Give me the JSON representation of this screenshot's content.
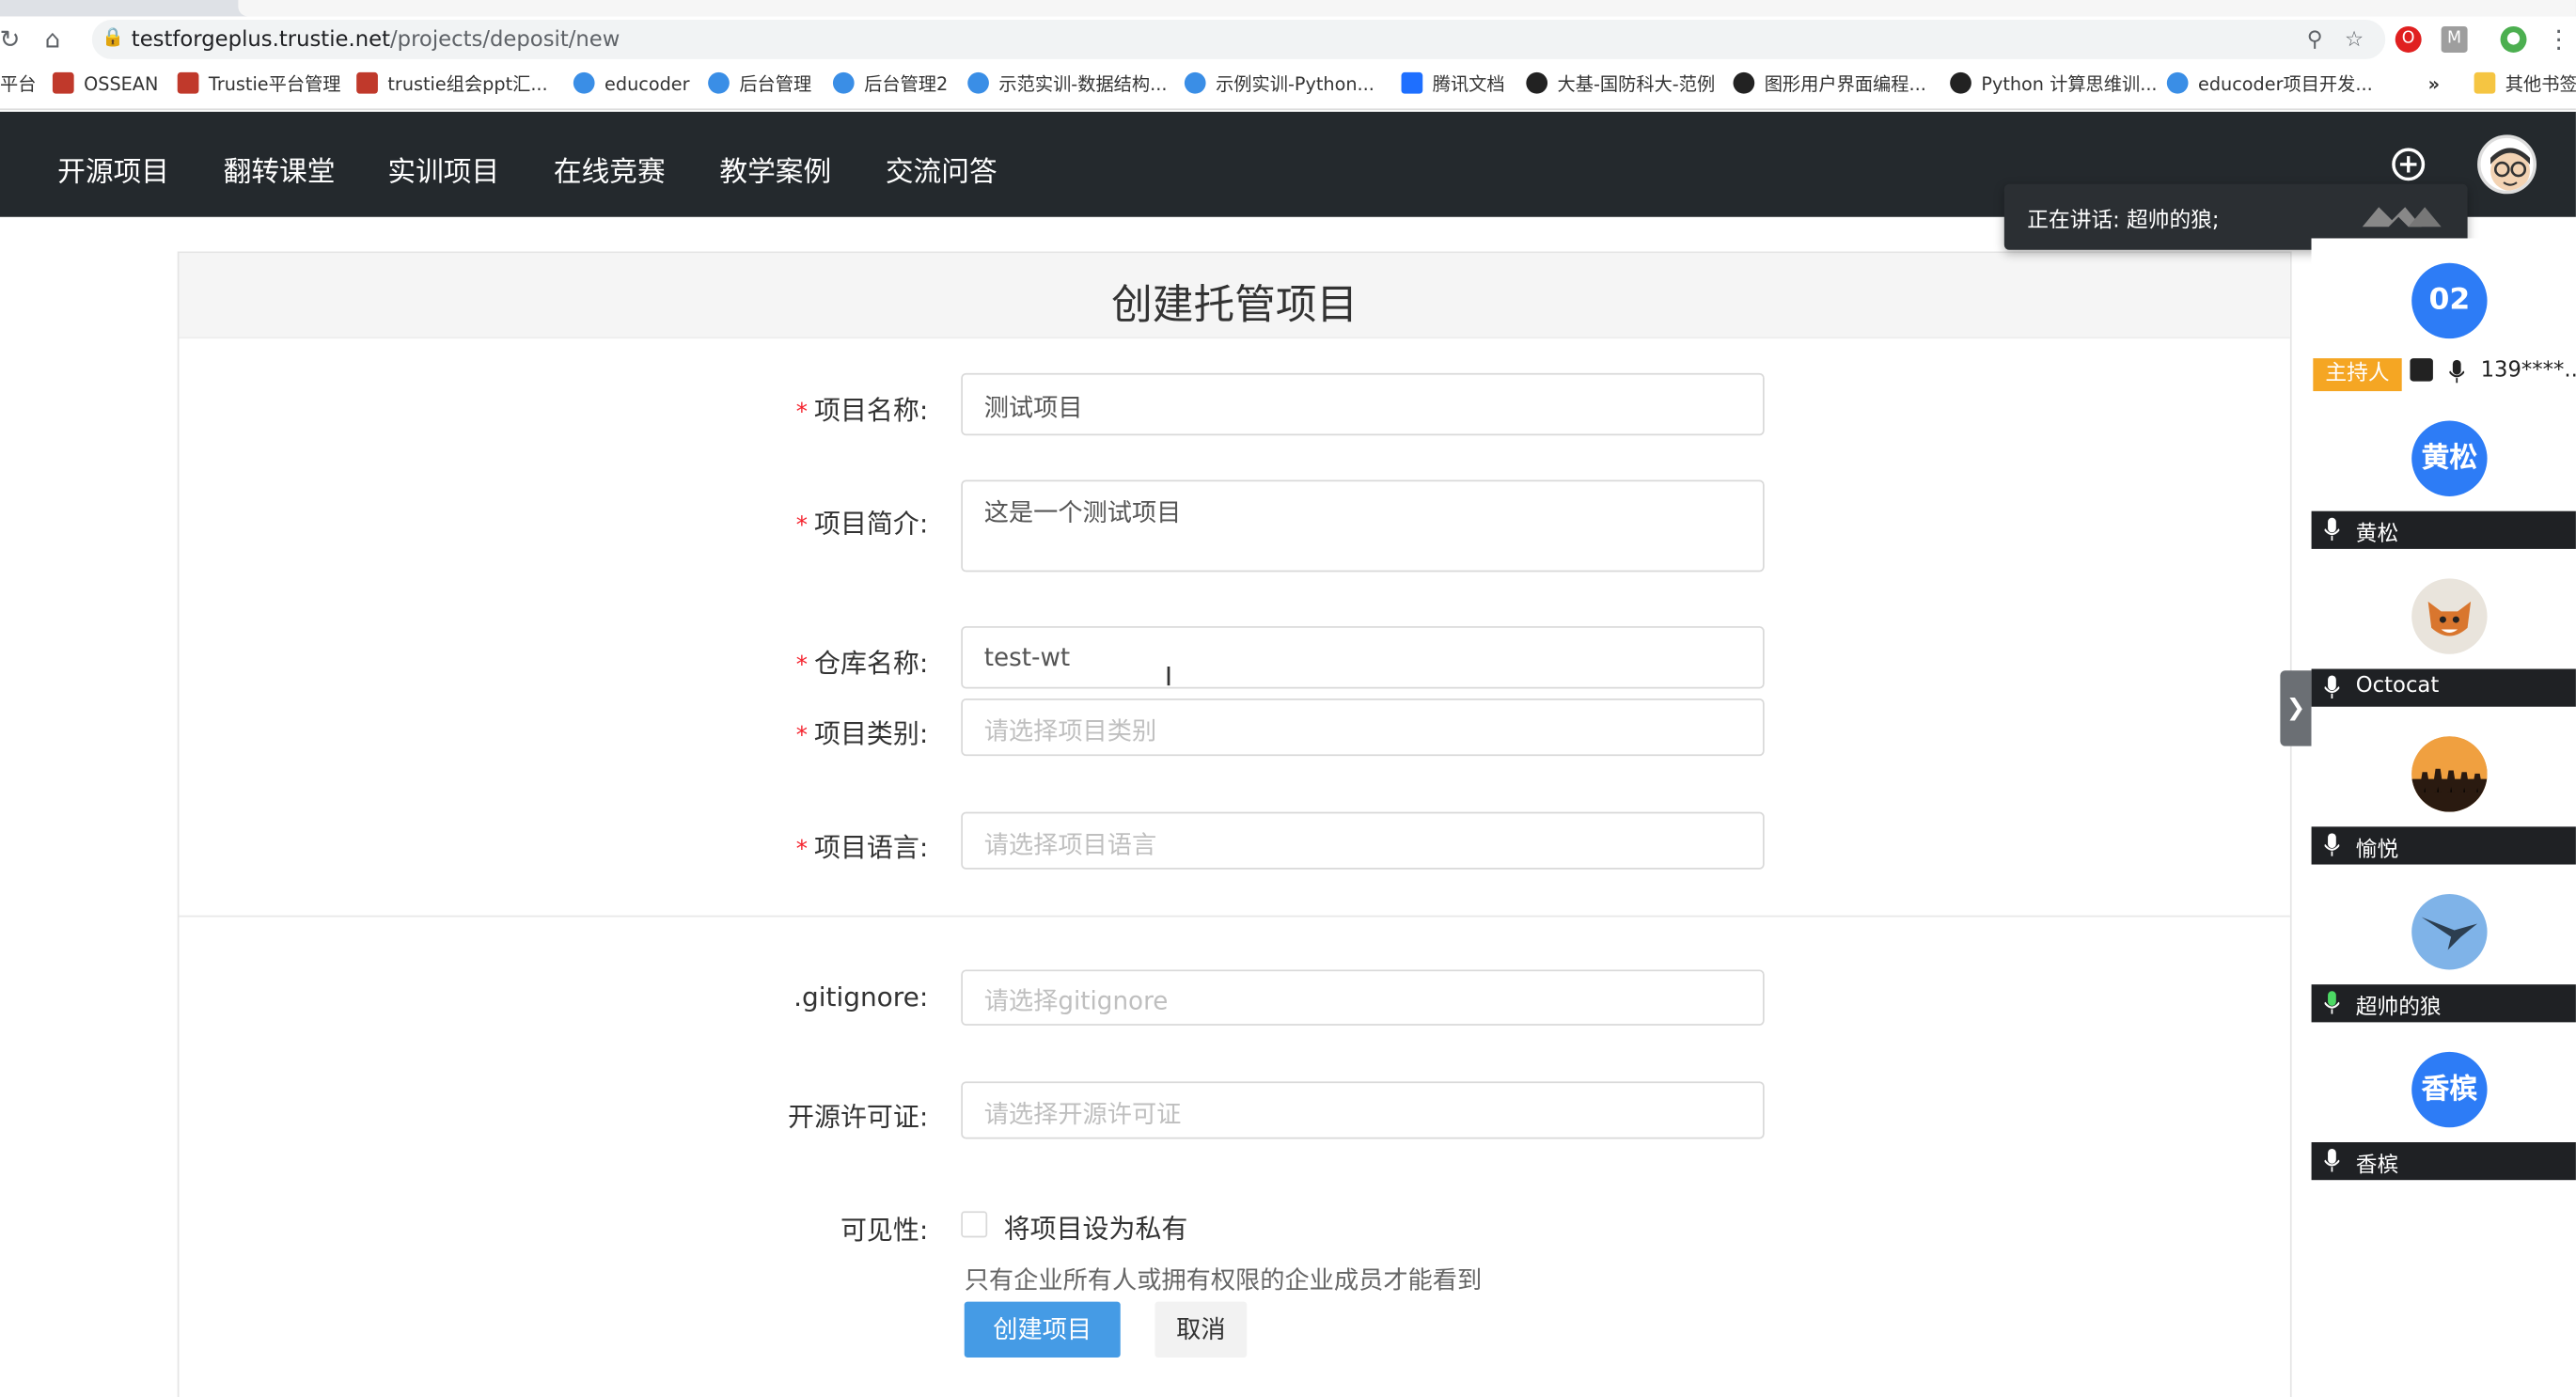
{
  "browser": {
    "url_host": "testforgeplus.trustie.net",
    "url_path": "/projects/deposit/new"
  },
  "bookmarks": [
    {
      "label": "平台",
      "icon": "bookmark-cut-icon"
    },
    {
      "label": "OSSEAN",
      "icon": "red-building-icon"
    },
    {
      "label": "Trustie平台管理",
      "icon": "red-building-icon"
    },
    {
      "label": "trustie组会ppt汇...",
      "icon": "red-building-icon"
    },
    {
      "label": "educoder",
      "icon": "blue-circle-icon"
    },
    {
      "label": "后台管理",
      "icon": "blue-circle-icon"
    },
    {
      "label": "后台管理2",
      "icon": "blue-circle-icon"
    },
    {
      "label": "示范实训-数据结构...",
      "icon": "blue-circle-icon"
    },
    {
      "label": "示例实训-Python...",
      "icon": "blue-circle-icon"
    },
    {
      "label": "腾讯文档",
      "icon": "tencent-docs-icon"
    },
    {
      "label": "大基-国防科大-范例",
      "icon": "github-icon"
    },
    {
      "label": "图形用户界面编程...",
      "icon": "github-icon"
    },
    {
      "label": "Python 计算思维训...",
      "icon": "github-icon"
    },
    {
      "label": "educoder项目开发...",
      "icon": "blue-circle-icon"
    },
    {
      "label": "»",
      "icon": ""
    },
    {
      "label": "其他书签",
      "icon": "folder-icon"
    }
  ],
  "nav": {
    "items": [
      "开源项目",
      "翻转课堂",
      "实训项目",
      "在线竞赛",
      "教学案例",
      "交流问答"
    ]
  },
  "form": {
    "title": "创建托管项目",
    "fields": {
      "name": {
        "label": "项目名称:",
        "value": "测试项目",
        "required": true
      },
      "desc": {
        "label": "项目简介:",
        "value": "这是一个测试项目",
        "required": true
      },
      "repo": {
        "label": "仓库名称:",
        "value": "test-wt",
        "required": true
      },
      "category": {
        "label": "项目类别:",
        "placeholder": "请选择项目类别",
        "required": true
      },
      "language": {
        "label": "项目语言:",
        "placeholder": "请选择项目语言",
        "required": true
      },
      "gitignore": {
        "label": ".gitignore:",
        "placeholder": "请选择gitignore"
      },
      "license": {
        "label": "开源许可证:",
        "placeholder": "请选择开源许可证"
      }
    },
    "visibility": {
      "label": "可见性:",
      "checkbox_label": "将项目设为私有",
      "checked": false,
      "hint": "只有企业所有人或拥有权限的企业成员才能看到"
    },
    "submit_label": "创建项目",
    "cancel_label": "取消",
    "required_mark": "*"
  },
  "meeting": {
    "speaking_text": "正在讲话: 超帅的狼;",
    "host_badge": "主持人",
    "participants": [
      {
        "avatar_text": "02",
        "name": "139****...",
        "color": "#2d7cf6",
        "host": true
      },
      {
        "avatar_text": "黄松",
        "name": "黄松",
        "color": "#2d7cf6"
      },
      {
        "avatar_text": "",
        "name": "Octocat",
        "color": "#e9e4dc",
        "icon": "fox-avatar-icon"
      },
      {
        "avatar_text": "",
        "name": "愉悦",
        "color": "#d88a3a",
        "icon": "sunset-group-avatar-icon"
      },
      {
        "avatar_text": "",
        "name": "超帅的狼",
        "color": "#7fb3e8",
        "icon": "bird-avatar-icon"
      },
      {
        "avatar_text": "香槟",
        "name": "香槟",
        "color": "#2d7cf6"
      }
    ]
  }
}
